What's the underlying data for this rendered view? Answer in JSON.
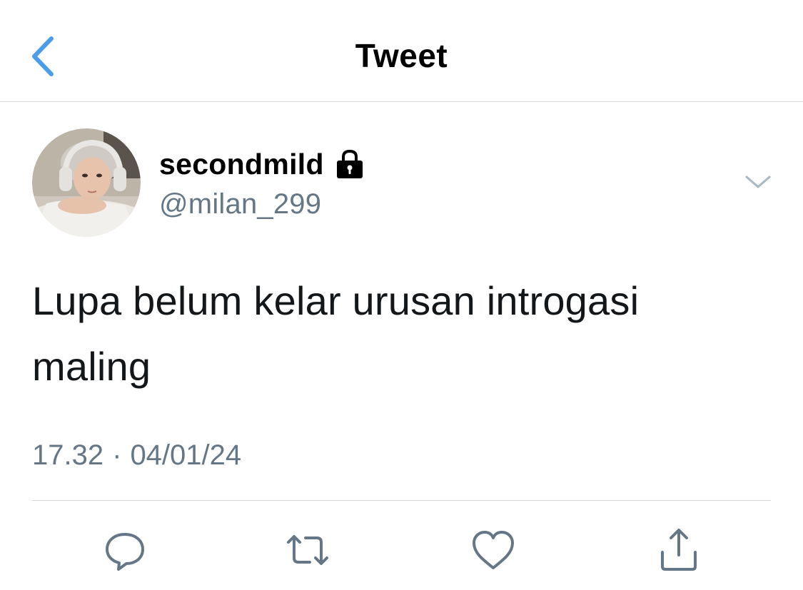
{
  "nav": {
    "title": "Tweet",
    "back_icon": "chevron-left-icon",
    "accent_color": "#4a9de8"
  },
  "tweet": {
    "author": {
      "display_name": "secondmild",
      "handle": "@milan_299",
      "protected_icon": "lock-icon",
      "avatar": "profile-photo"
    },
    "menu_icon": "chevron-down-icon",
    "text_line_1": "Lupa belum kelar urusan introgasi",
    "text_line_2": "maling",
    "time": "17.32",
    "separator": "·",
    "date": "04/01/24"
  },
  "actions": [
    {
      "icon": "reply-icon"
    },
    {
      "icon": "retweet-icon"
    },
    {
      "icon": "like-icon"
    },
    {
      "icon": "share-icon"
    }
  ],
  "colors": {
    "text": "#14171a",
    "secondary": "#657786",
    "divider": "#d6d9dc"
  }
}
